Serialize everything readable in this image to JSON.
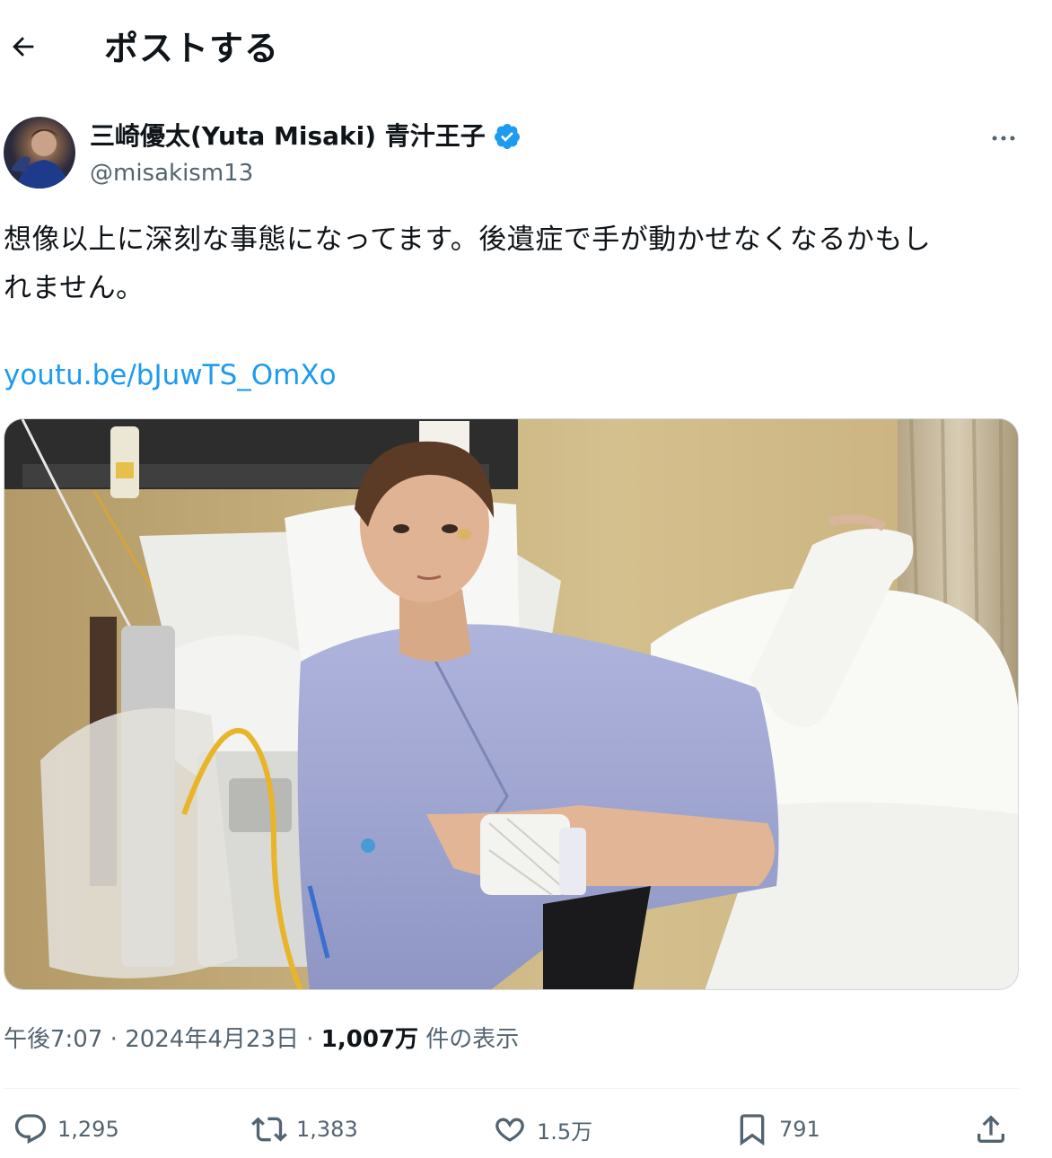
{
  "header": {
    "title": "ポストする",
    "back_icon": "arrow-left-icon"
  },
  "author": {
    "display_name": "三崎優太(Yuta Misaki) 青汁王子",
    "handle": "@misakism13",
    "verified_color": "#1d9bf0"
  },
  "tweet": {
    "text_line1": "想像以上に深刻な事態になってます。後遺症で手が動かせなくなるかもし",
    "text_line2": "れません。",
    "link": "youtu.be/bJuwTS_OmXo",
    "link_color": "#1d9bf0"
  },
  "meta": {
    "time": "午後7:07",
    "separator": "·",
    "date": "2024年4月23日",
    "views_count": "1,007万",
    "views_label": "件の表示"
  },
  "actions": {
    "reply_count": "1,295",
    "retweet_count": "1,383",
    "like_count": "1.5万",
    "bookmark_count": "791"
  }
}
